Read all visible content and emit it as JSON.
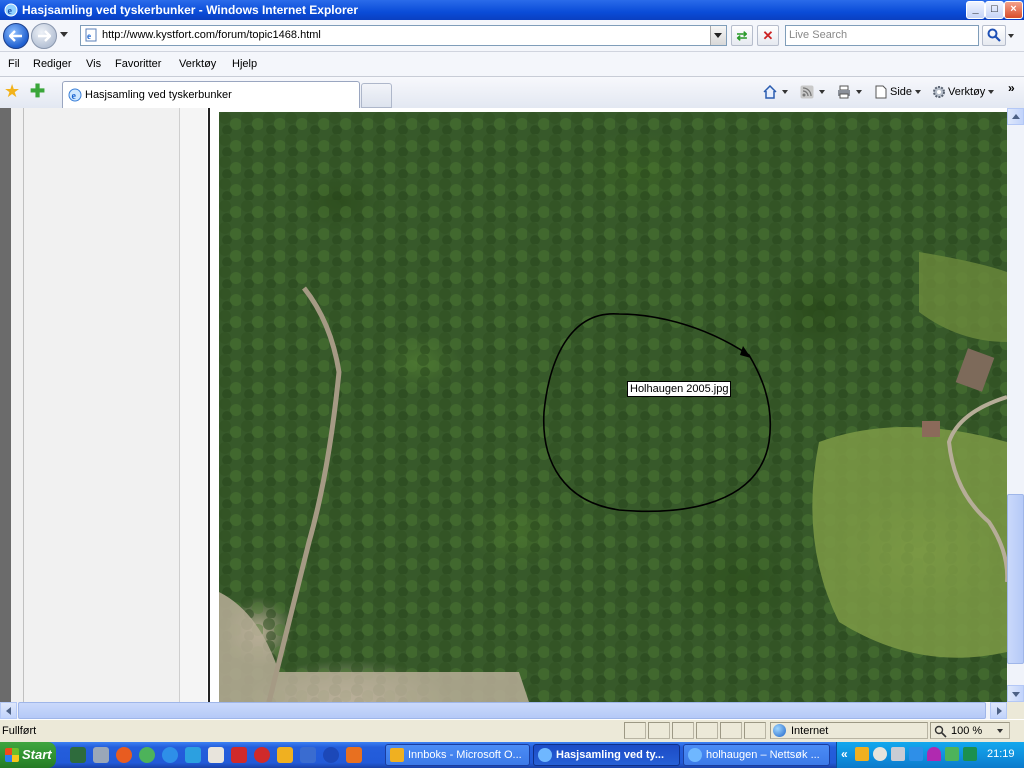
{
  "window": {
    "title": "Hasjsamling ved tyskerbunker - Windows Internet Explorer",
    "buttons": {
      "minimize": "_",
      "maximize": "□",
      "close": "×"
    }
  },
  "address_bar": {
    "url": "http://www.kystfort.com/forum/topic1468.html",
    "search_placeholder": "Live Search"
  },
  "menu": {
    "items": [
      "Fil",
      "Rediger",
      "Vis",
      "Favoritter",
      "Verktøy",
      "Hjelp"
    ]
  },
  "tabs": {
    "active_label": "Hasjsamling ved tyskerbunker"
  },
  "command_bar": {
    "page_label": "Side",
    "tools_label": "Verktøy",
    "more": "»"
  },
  "content": {
    "map_tooltip": "Holhaugen 2005.jpg"
  },
  "status_bar": {
    "status_text": "Fullført",
    "zone_label": "Internet",
    "zoom_label": "100 %"
  },
  "taskbar": {
    "start_label": "Start",
    "tasks": [
      {
        "label": "Innboks - Microsoft O...",
        "active": false
      },
      {
        "label": "Hasjsamling ved ty...",
        "active": true
      },
      {
        "label": "holhaugen – Nettsøk ...",
        "active": false
      }
    ],
    "tray_more": "«",
    "clock": "21:19"
  },
  "colors": {
    "titlebar": "#0a4cd8",
    "forest": "#37592a",
    "taskbar": "#245edc",
    "start_green": "#3fa53f"
  }
}
